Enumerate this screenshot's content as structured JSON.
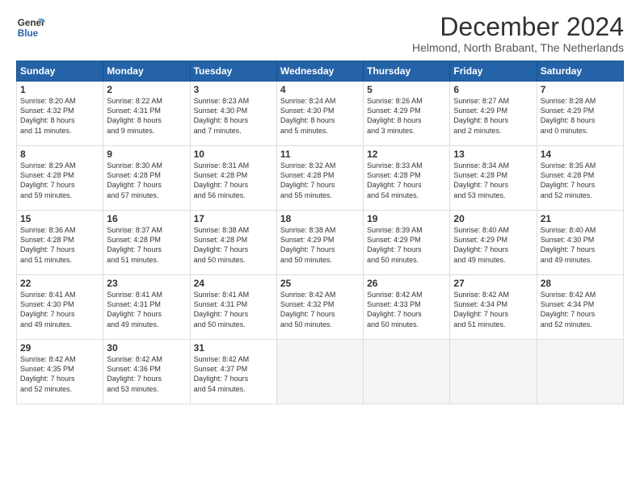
{
  "header": {
    "logo_line1": "General",
    "logo_line2": "Blue",
    "main_title": "December 2024",
    "subtitle": "Helmond, North Brabant, The Netherlands"
  },
  "weekdays": [
    "Sunday",
    "Monday",
    "Tuesday",
    "Wednesday",
    "Thursday",
    "Friday",
    "Saturday"
  ],
  "weeks": [
    [
      {
        "day": "1",
        "info": "Sunrise: 8:20 AM\nSunset: 4:32 PM\nDaylight: 8 hours\nand 11 minutes."
      },
      {
        "day": "2",
        "info": "Sunrise: 8:22 AM\nSunset: 4:31 PM\nDaylight: 8 hours\nand 9 minutes."
      },
      {
        "day": "3",
        "info": "Sunrise: 8:23 AM\nSunset: 4:30 PM\nDaylight: 8 hours\nand 7 minutes."
      },
      {
        "day": "4",
        "info": "Sunrise: 8:24 AM\nSunset: 4:30 PM\nDaylight: 8 hours\nand 5 minutes."
      },
      {
        "day": "5",
        "info": "Sunrise: 8:26 AM\nSunset: 4:29 PM\nDaylight: 8 hours\nand 3 minutes."
      },
      {
        "day": "6",
        "info": "Sunrise: 8:27 AM\nSunset: 4:29 PM\nDaylight: 8 hours\nand 2 minutes."
      },
      {
        "day": "7",
        "info": "Sunrise: 8:28 AM\nSunset: 4:29 PM\nDaylight: 8 hours\nand 0 minutes."
      }
    ],
    [
      {
        "day": "8",
        "info": "Sunrise: 8:29 AM\nSunset: 4:28 PM\nDaylight: 7 hours\nand 59 minutes."
      },
      {
        "day": "9",
        "info": "Sunrise: 8:30 AM\nSunset: 4:28 PM\nDaylight: 7 hours\nand 57 minutes."
      },
      {
        "day": "10",
        "info": "Sunrise: 8:31 AM\nSunset: 4:28 PM\nDaylight: 7 hours\nand 56 minutes."
      },
      {
        "day": "11",
        "info": "Sunrise: 8:32 AM\nSunset: 4:28 PM\nDaylight: 7 hours\nand 55 minutes."
      },
      {
        "day": "12",
        "info": "Sunrise: 8:33 AM\nSunset: 4:28 PM\nDaylight: 7 hours\nand 54 minutes."
      },
      {
        "day": "13",
        "info": "Sunrise: 8:34 AM\nSunset: 4:28 PM\nDaylight: 7 hours\nand 53 minutes."
      },
      {
        "day": "14",
        "info": "Sunrise: 8:35 AM\nSunset: 4:28 PM\nDaylight: 7 hours\nand 52 minutes."
      }
    ],
    [
      {
        "day": "15",
        "info": "Sunrise: 8:36 AM\nSunset: 4:28 PM\nDaylight: 7 hours\nand 51 minutes."
      },
      {
        "day": "16",
        "info": "Sunrise: 8:37 AM\nSunset: 4:28 PM\nDaylight: 7 hours\nand 51 minutes."
      },
      {
        "day": "17",
        "info": "Sunrise: 8:38 AM\nSunset: 4:28 PM\nDaylight: 7 hours\nand 50 minutes."
      },
      {
        "day": "18",
        "info": "Sunrise: 8:38 AM\nSunset: 4:29 PM\nDaylight: 7 hours\nand 50 minutes."
      },
      {
        "day": "19",
        "info": "Sunrise: 8:39 AM\nSunset: 4:29 PM\nDaylight: 7 hours\nand 50 minutes."
      },
      {
        "day": "20",
        "info": "Sunrise: 8:40 AM\nSunset: 4:29 PM\nDaylight: 7 hours\nand 49 minutes."
      },
      {
        "day": "21",
        "info": "Sunrise: 8:40 AM\nSunset: 4:30 PM\nDaylight: 7 hours\nand 49 minutes."
      }
    ],
    [
      {
        "day": "22",
        "info": "Sunrise: 8:41 AM\nSunset: 4:30 PM\nDaylight: 7 hours\nand 49 minutes."
      },
      {
        "day": "23",
        "info": "Sunrise: 8:41 AM\nSunset: 4:31 PM\nDaylight: 7 hours\nand 49 minutes."
      },
      {
        "day": "24",
        "info": "Sunrise: 8:41 AM\nSunset: 4:31 PM\nDaylight: 7 hours\nand 50 minutes."
      },
      {
        "day": "25",
        "info": "Sunrise: 8:42 AM\nSunset: 4:32 PM\nDaylight: 7 hours\nand 50 minutes."
      },
      {
        "day": "26",
        "info": "Sunrise: 8:42 AM\nSunset: 4:33 PM\nDaylight: 7 hours\nand 50 minutes."
      },
      {
        "day": "27",
        "info": "Sunrise: 8:42 AM\nSunset: 4:34 PM\nDaylight: 7 hours\nand 51 minutes."
      },
      {
        "day": "28",
        "info": "Sunrise: 8:42 AM\nSunset: 4:34 PM\nDaylight: 7 hours\nand 52 minutes."
      }
    ],
    [
      {
        "day": "29",
        "info": "Sunrise: 8:42 AM\nSunset: 4:35 PM\nDaylight: 7 hours\nand 52 minutes."
      },
      {
        "day": "30",
        "info": "Sunrise: 8:42 AM\nSunset: 4:36 PM\nDaylight: 7 hours\nand 53 minutes."
      },
      {
        "day": "31",
        "info": "Sunrise: 8:42 AM\nSunset: 4:37 PM\nDaylight: 7 hours\nand 54 minutes."
      },
      {
        "day": "",
        "info": ""
      },
      {
        "day": "",
        "info": ""
      },
      {
        "day": "",
        "info": ""
      },
      {
        "day": "",
        "info": ""
      }
    ]
  ]
}
